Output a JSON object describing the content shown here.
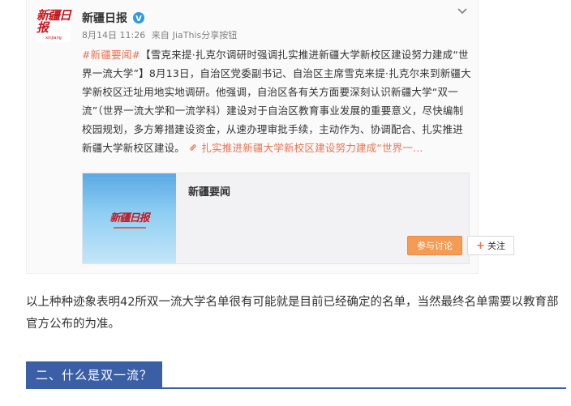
{
  "weibo_post": {
    "author": "新疆日报",
    "avatar_logo_text": "新疆日报",
    "meta": {
      "date": "8月14日 11:26",
      "source_prefix": "来自",
      "source": "JiaThis分享按钮"
    },
    "topic": "#新疆要闻#",
    "body": "【雪克来提·扎克尔调研时强调扎实推进新疆大学新校区建设努力建成“世界一流大学”】8月13日，自治区党委副书记、自治区主席雪克来提·扎克尔来到新疆大学新校区迁址用地实地调研。他强调，自治区各有关方面要深刻认识新疆大学“双一流”（世界一流大学和一流学科）建设对于自治区教育事业发展的重要意义，尽快编制校园规划，多方筹措建设资金，从速办理审批手续，主动作为、协调配合、扎实推进新疆大学新校区建设。",
    "link_text": "扎实推进新疆大学新校区建设努力建成“世界一...",
    "card": {
      "title": "新疆要闻",
      "thumb_logo": "新疆日报",
      "discuss_label": "参与讨论",
      "follow_label": "关注"
    }
  },
  "article": {
    "paragraph": "以上种种迹象表明42所双一流大学名单很有可能就是目前已经确定的名单，当然最终名单需要以教育部官方公布的为准。",
    "section_heading": "二、什么是双一流？"
  },
  "colors": {
    "accent_orange": "#eb7350",
    "discuss_button": "#f49b55",
    "heading_blue": "#3a5fa5",
    "verified_blue": "#2b9ae8",
    "logo_red": "#c8161d"
  },
  "icons": [
    "verified-icon",
    "chevron-down-icon",
    "link-icon",
    "plus-icon"
  ]
}
